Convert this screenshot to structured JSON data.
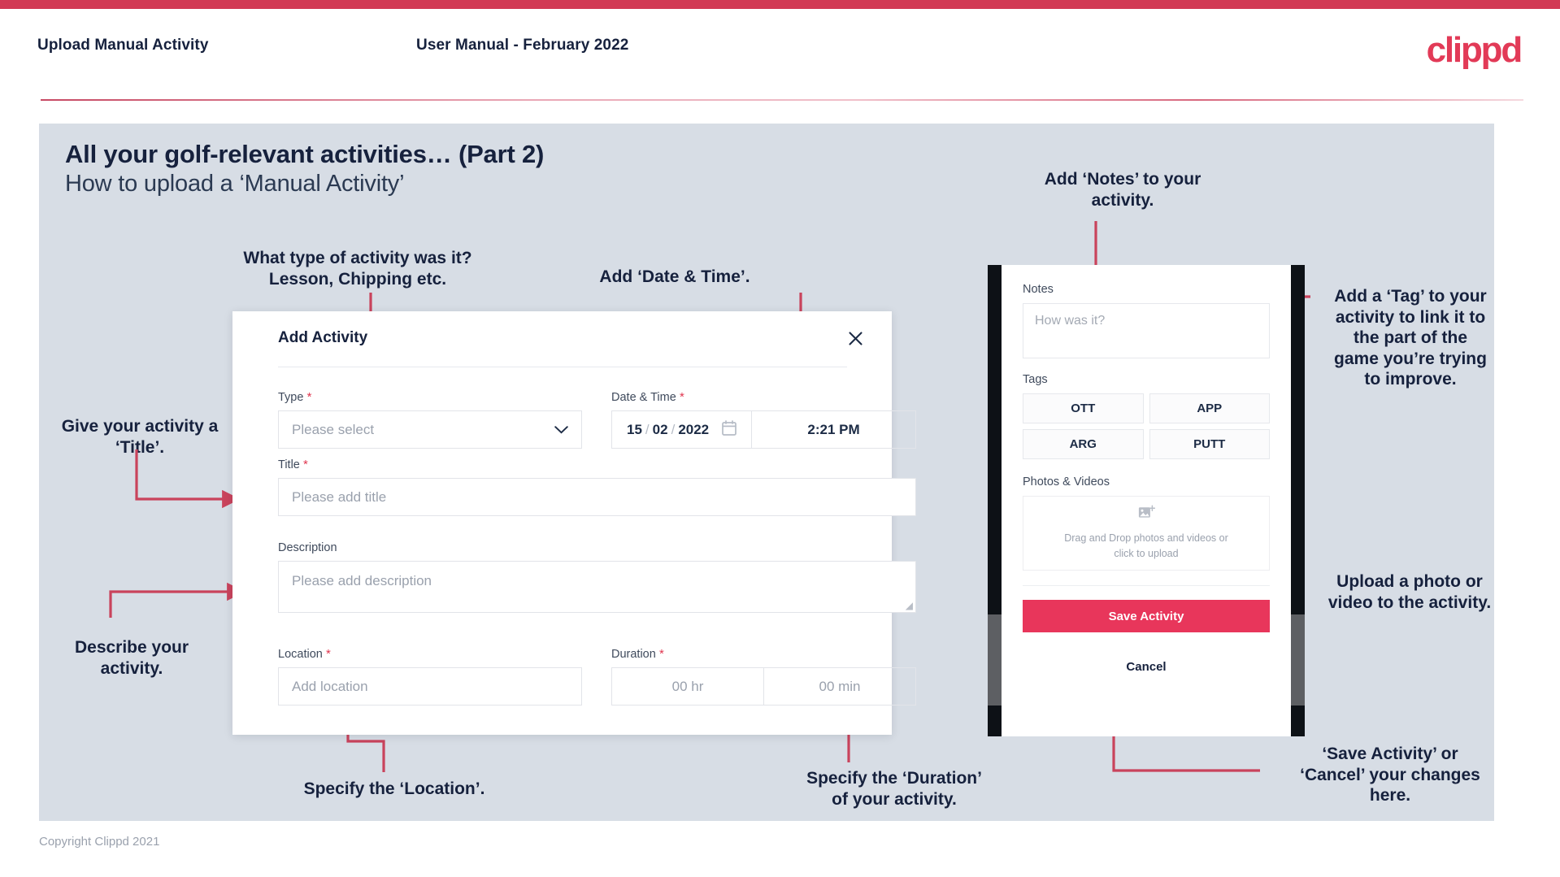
{
  "header": {
    "title": "Upload Manual Activity",
    "subtitle": "User Manual - February 2022",
    "brand": "clippd"
  },
  "slide": {
    "title": "All your golf-relevant activities… (Part 2)",
    "subtitle": "How to upload a ‘Manual Activity’"
  },
  "annotations": {
    "type": "What type of activity was it?\nLesson, Chipping etc.",
    "datetime": "Add ‘Date & Time’.",
    "title": "Give your activity a\n‘Title’.",
    "description": "Describe your\nactivity.",
    "location": "Specify the ‘Location’.",
    "duration": "Specify the ‘Duration’\nof your activity.",
    "notes": "Add ‘Notes’ to your\nactivity.",
    "tags": "Add a ‘Tag’ to your\nactivity to link it to\nthe part of the\ngame you’re trying\nto improve.",
    "upload": "Upload a photo or\nvideo to the activity.",
    "save": "‘Save Activity’ or\n‘Cancel’ your changes\nhere."
  },
  "dialog": {
    "title": "Add Activity",
    "close_icon": "close-icon",
    "fields": {
      "type": {
        "label": "Type",
        "required": true,
        "placeholder": "Please select"
      },
      "datetime": {
        "label": "Date & Time",
        "required": true,
        "day": "15",
        "month": "02",
        "year": "2022",
        "separator": "/",
        "time": "2:21 PM",
        "calendar_icon": "calendar-icon"
      },
      "title": {
        "label": "Title",
        "required": true,
        "placeholder": "Please add title"
      },
      "description": {
        "label": "Description",
        "required": false,
        "placeholder": "Please add description"
      },
      "location": {
        "label": "Location",
        "required": true,
        "placeholder": "Add location"
      },
      "duration": {
        "label": "Duration",
        "required": true,
        "hours": "00 hr",
        "minutes": "00 min"
      }
    }
  },
  "phone": {
    "notes": {
      "label": "Notes",
      "placeholder": "How was it?"
    },
    "tags": {
      "label": "Tags",
      "options": [
        "OTT",
        "APP",
        "ARG",
        "PUTT"
      ]
    },
    "photos": {
      "label": "Photos & Videos",
      "icon": "add-image-icon",
      "hint_line1": "Drag and Drop photos and videos or",
      "hint_line2": "click to upload"
    },
    "save_label": "Save Activity",
    "cancel_label": "Cancel"
  },
  "footer": {
    "copyright": "Copyright Clippd 2021"
  },
  "colors": {
    "accent": "#e23a57",
    "save_button": "#e8365b",
    "arrow": "#c9435c",
    "slide_bg": "#d7dde5",
    "text_dark": "#16213d",
    "required_star": "#e0364f"
  }
}
